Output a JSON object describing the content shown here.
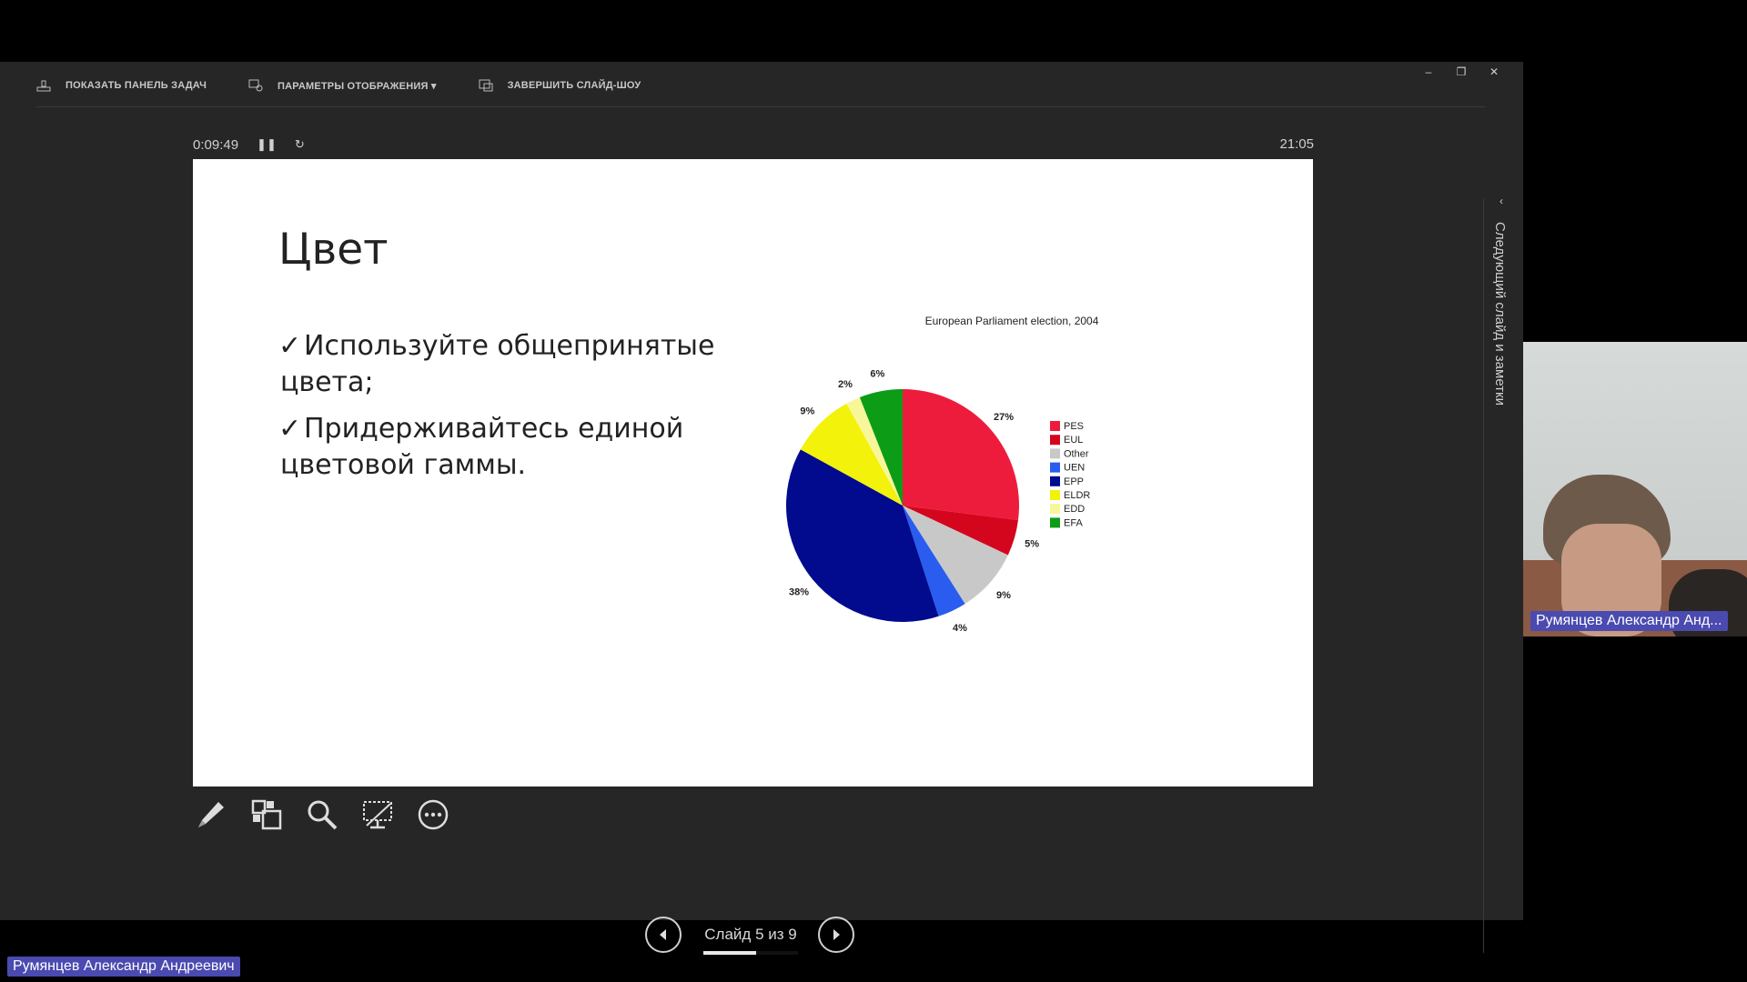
{
  "toolbar": {
    "show_taskbar": "ПОКАЗАТЬ ПАНЕЛЬ ЗАДАЧ",
    "display_settings": "ПАРАМЕТРЫ ОТОБРАЖЕНИЯ ▾",
    "end_show": "ЗАВЕРШИТЬ СЛАЙД-ШОУ"
  },
  "window_controls": {
    "minimize": "–",
    "restore": "❐",
    "close": "✕"
  },
  "timer": {
    "elapsed": "0:09:49",
    "pause_icon": "pause-icon",
    "reset_icon": "reset-icon",
    "clock": "21:05"
  },
  "slide": {
    "title": "Цвет",
    "bullets": [
      {
        "mark": "✓",
        "text": "Используйте общепринятые цвета;"
      },
      {
        "mark": "✓",
        "text": "Придерживайтесь единой цветовой гаммы."
      }
    ]
  },
  "chart_data": {
    "type": "pie",
    "title": "European Parliament election, 2004",
    "slices": [
      {
        "label": "PES",
        "value": 27,
        "color": "#ee1c3c",
        "value_label": "27%"
      },
      {
        "label": "EUL",
        "value": 5,
        "color": "#d4061e",
        "value_label": "5%"
      },
      {
        "label": "Other",
        "value": 9,
        "color": "#c8c8c8",
        "value_label": "9%"
      },
      {
        "label": "UEN",
        "value": 4,
        "color": "#2a5cf0",
        "value_label": "4%"
      },
      {
        "label": "EPP",
        "value": 38,
        "color": "#020a8e",
        "value_label": "38%"
      },
      {
        "label": "ELDR",
        "value": 9,
        "color": "#f2f20a",
        "value_label": "9%"
      },
      {
        "label": "EDD",
        "value": 2,
        "color": "#f7f79a",
        "value_label": "2%"
      },
      {
        "label": "EFA",
        "value": 6,
        "color": "#0c9c16",
        "value_label": "6%"
      }
    ],
    "legend_placement": "right"
  },
  "tools": [
    "pen-icon",
    "grid-icon",
    "zoom-icon",
    "screen-icon",
    "more-icon"
  ],
  "navigation": {
    "counter": "Слайд 5 из 9",
    "current": 5,
    "total": 9,
    "progress": 0.56
  },
  "sidebar": {
    "label": "Следующий слайд и заметки",
    "toggle": "‹"
  },
  "participants": {
    "video_name": "Румянцев Александр Анд...",
    "bottom_name": "Румянцев Александр Андреевич"
  }
}
